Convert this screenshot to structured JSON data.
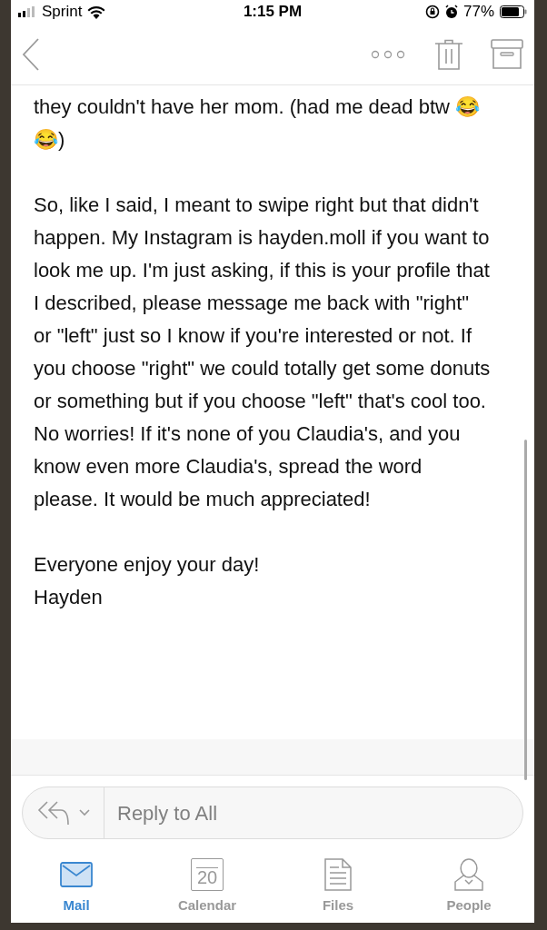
{
  "status_bar": {
    "carrier": "Sprint",
    "time": "1:15 PM",
    "battery": "77%"
  },
  "message": {
    "paragraphs": [
      "they couldn't have her mom. (had me dead btw 😂😂)",
      "So, like I said, I meant to swipe right but that didn't happen. My Instagram is hayden.moll if you want to look me up. I'm just asking, if this is your profile that I described, please message me back with \"right\" or \"left\" just so I know if you're interested or not. If you choose \"right\" we could totally get some donuts or something but if you choose \"left\" that's cool too. No worries! If it's none of you Claudia's, and you know even more Claudia's, spread the word please. It would be much appreciated!"
    ],
    "signature": [
      "Everyone enjoy your day!",
      "Hayden"
    ]
  },
  "reply_bar": {
    "placeholder": "Reply to All"
  },
  "tab_bar": [
    {
      "label": "Mail",
      "kind": "mail",
      "selected": true
    },
    {
      "label": "Calendar",
      "kind": "calendar",
      "selected": false,
      "icon_text": "20"
    },
    {
      "label": "Files",
      "kind": "files",
      "selected": false
    },
    {
      "label": "People",
      "kind": "people",
      "selected": false
    }
  ]
}
